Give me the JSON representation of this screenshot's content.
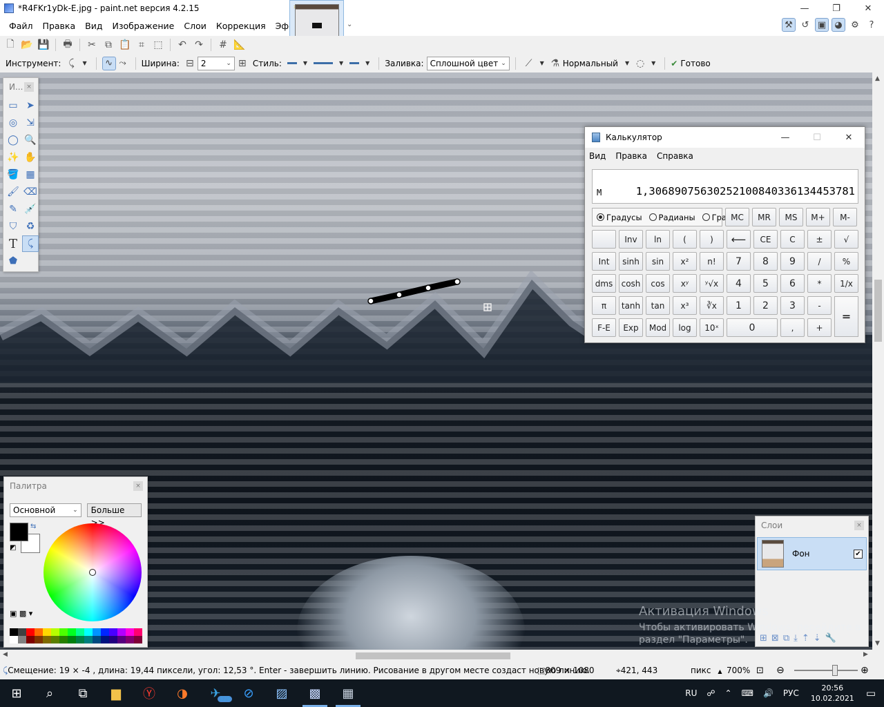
{
  "window": {
    "title": "*R4FKr1yDk-E.jpg - paint.net версия 4.2.15"
  },
  "menu": [
    "Файл",
    "Правка",
    "Вид",
    "Изображение",
    "Слои",
    "Коррекция",
    "Эффекты"
  ],
  "options": {
    "tool_label": "Инструмент:",
    "width_label": "Ширина:",
    "width_value": "2",
    "style_label": "Стиль:",
    "fill_label": "Заливка:",
    "fill_value": "Сплошной цвет",
    "blend_value": "Нормальный",
    "done_label": "Готово"
  },
  "tools_panel": {
    "title": "И..."
  },
  "palette": {
    "title": "Палитра",
    "select_value": "Основной",
    "more_label": "Больше >>",
    "primary_color": "#000000",
    "secondary_color": "#ffffff",
    "swatch_colors": [
      "#000000",
      "#404040",
      "#ff0000",
      "#ff6a00",
      "#ffd800",
      "#b6ff00",
      "#4cff00",
      "#00ff21",
      "#00ff90",
      "#00ffff",
      "#0094ff",
      "#0026ff",
      "#4800ff",
      "#b200ff",
      "#ff00dc",
      "#ff006e",
      "#ffffff",
      "#808080",
      "#7f0000",
      "#7f3300",
      "#7f6a00",
      "#5b7f00",
      "#267f00",
      "#007f0e",
      "#007f46",
      "#007f7f",
      "#004a7f",
      "#00137f",
      "#21007f",
      "#57007f",
      "#7f006e",
      "#7f0037"
    ]
  },
  "layers": {
    "title": "Слои",
    "items": [
      {
        "name": "Фон",
        "visible": true
      }
    ]
  },
  "calculator": {
    "title": "Калькулятор",
    "menu": [
      "Вид",
      "Правка",
      "Справка"
    ],
    "memory_indicator": "M",
    "display": "1,30689075630252100840336134453781",
    "angle_modes": [
      "Градусы",
      "Радианы",
      "Грады"
    ],
    "selected_mode": "Градусы",
    "memory_keys": [
      "MC",
      "MR",
      "MS",
      "M+",
      "M-"
    ],
    "rows": [
      [
        "",
        "Inv",
        "ln",
        "(",
        ")",
        "⟵",
        "CE",
        "C",
        "±",
        "√"
      ],
      [
        "Int",
        "sinh",
        "sin",
        "x²",
        "n!",
        "7",
        "8",
        "9",
        "/",
        "%"
      ],
      [
        "dms",
        "cosh",
        "cos",
        "xʸ",
        "ʸ√x",
        "4",
        "5",
        "6",
        "*",
        "1/x"
      ],
      [
        "π",
        "tanh",
        "tan",
        "x³",
        "∛x",
        "1",
        "2",
        "3",
        "-"
      ],
      [
        "F-E",
        "Exp",
        "Mod",
        "log",
        "10ˣ",
        "0",
        ",",
        "+"
      ]
    ],
    "equals": "="
  },
  "watermark": {
    "line1": "Активация Windows",
    "line2": "Чтобы активировать Windows, перейдите в",
    "line3": "раздел \"Параметры\"."
  },
  "status": {
    "message": "Смещение: 19  × -4 , длина: 19,44 пиксели, угол: 12,53 °. Enter - завершить линию. Рисование в другом месте создаст новую линию.",
    "image_size": "809 × 1080",
    "cursor_pos": "421, 443",
    "units": "пикс",
    "zoom": "700%"
  },
  "taskbar": {
    "telegram_badge": "329",
    "lang": "RU",
    "input_lang": "РУС",
    "time": "20:56",
    "date": "10.02.2021"
  }
}
